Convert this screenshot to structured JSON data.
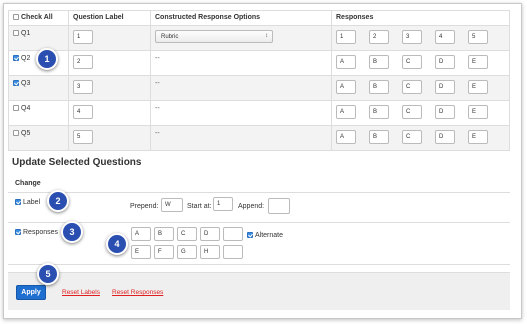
{
  "table": {
    "headers": {
      "check_all": "Check All",
      "question_label": "Question Label",
      "cr_options": "Constructed Response Options",
      "responses": "Responses"
    },
    "rows": [
      {
        "name": "Q1",
        "checked": false,
        "label": "1",
        "cr": "Rubric",
        "responses": [
          "1",
          "2",
          "3",
          "4",
          "5"
        ]
      },
      {
        "name": "Q2",
        "checked": true,
        "label": "2",
        "cr": "--",
        "responses": [
          "A",
          "B",
          "C",
          "D",
          "E"
        ]
      },
      {
        "name": "Q3",
        "checked": true,
        "label": "3",
        "cr": "--",
        "responses": [
          "A",
          "B",
          "C",
          "D",
          "E"
        ]
      },
      {
        "name": "Q4",
        "checked": false,
        "label": "4",
        "cr": "--",
        "responses": [
          "A",
          "B",
          "C",
          "D",
          "E"
        ]
      },
      {
        "name": "Q5",
        "checked": false,
        "label": "5",
        "cr": "--",
        "responses": [
          "A",
          "B",
          "C",
          "D",
          "E"
        ]
      }
    ]
  },
  "update": {
    "title": "Update Selected Questions",
    "change_label": "Change",
    "label_option": "Label",
    "prepend_label": "Prepend:",
    "prepend_value": "W",
    "start_label": "Start at:",
    "start_value": "1",
    "append_label": "Append:",
    "append_value": "",
    "responses_option": "Responses",
    "responses_row1": [
      "A",
      "B",
      "C",
      "D",
      ""
    ],
    "responses_row2": [
      "E",
      "F",
      "G",
      "H",
      ""
    ],
    "alternate_label": "Alternate"
  },
  "footer": {
    "apply": "Apply",
    "reset_labels": "Reset Labels",
    "reset_responses": "Reset Responses"
  },
  "callouts": [
    "1",
    "2",
    "3",
    "4",
    "5"
  ],
  "colors": {
    "callout": "#2a4fb0",
    "apply": "#1f6fd0",
    "link": "#e02020",
    "checkbox_checked": "#3b8de0"
  }
}
